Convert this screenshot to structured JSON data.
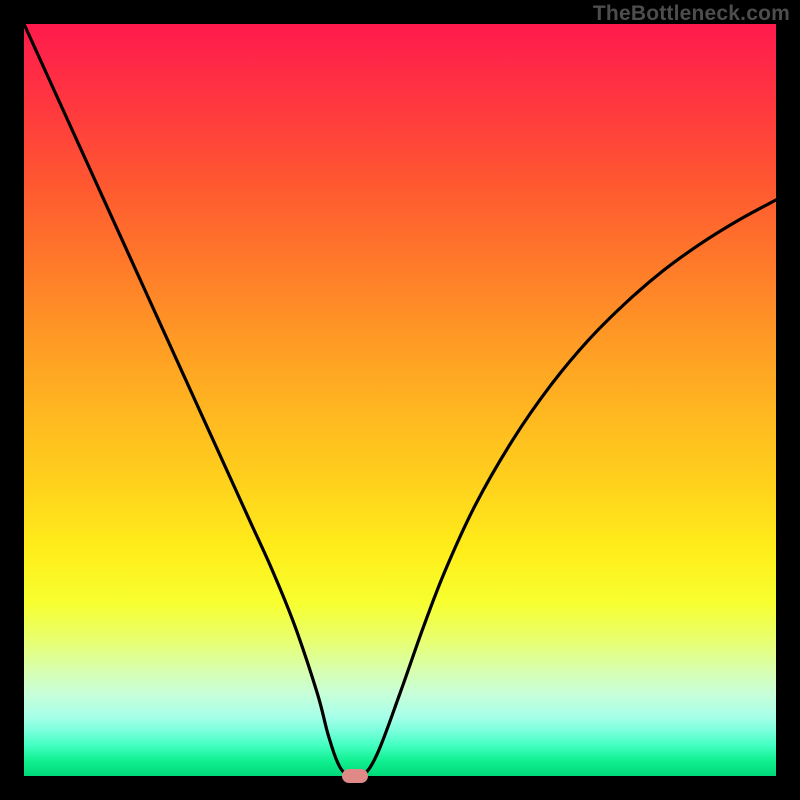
{
  "watermark": "TheBottleneck.com",
  "colors": {
    "frame": "#000000",
    "curve": "#000000",
    "marker": "#e08a88"
  },
  "chart_data": {
    "type": "line",
    "title": "",
    "xlabel": "",
    "ylabel": "",
    "xlim": [
      0,
      100
    ],
    "ylim": [
      0,
      100
    ],
    "grid": false,
    "legend": false,
    "series": [
      {
        "name": "bottleneck-curve",
        "x": [
          0,
          3,
          6,
          9,
          12,
          15,
          18,
          21,
          24,
          27,
          30,
          33,
          36,
          39,
          40.5,
          42,
          43.5,
          45,
          47,
          50,
          53,
          56,
          60,
          65,
          70,
          75,
          80,
          85,
          90,
          95,
          100
        ],
        "y": [
          100,
          93.4,
          86.8,
          80.2,
          73.6,
          67,
          60.4,
          53.8,
          47.2,
          40.6,
          34,
          27.4,
          20,
          11,
          5.3,
          1.2,
          0,
          0,
          3,
          11,
          19.5,
          27.3,
          36,
          44.7,
          51.9,
          57.9,
          62.9,
          67.2,
          70.8,
          73.9,
          76.6
        ]
      }
    ],
    "markers": [
      {
        "name": "optimum-marker",
        "x": 44,
        "y": 0
      }
    ]
  }
}
